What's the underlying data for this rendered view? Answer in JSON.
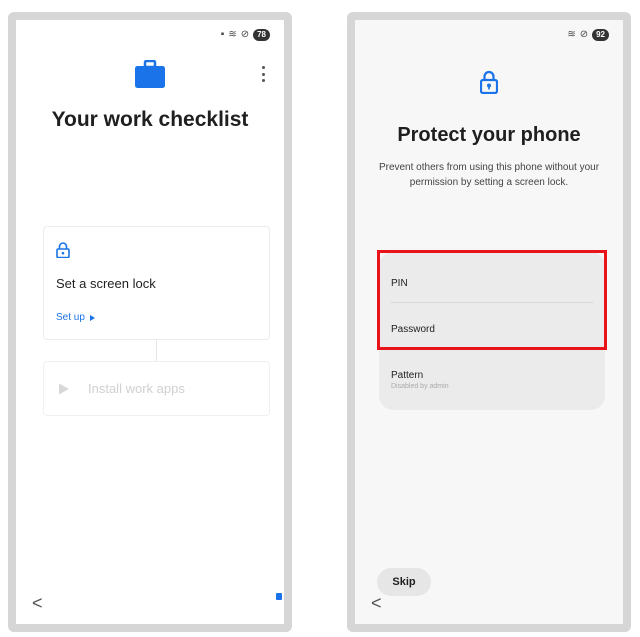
{
  "left_screen": {
    "status": {
      "battery": "78"
    },
    "title": "Your work checklist",
    "tasks": [
      {
        "label": "Set a screen lock",
        "action": "Set up"
      },
      {
        "label": "Install work apps"
      }
    ],
    "colors": {
      "accent": "#1a73e8"
    }
  },
  "right_screen": {
    "status": {
      "battery": "92"
    },
    "title": "Protect your phone",
    "description": "Prevent others from using this phone without your permission by setting a screen lock.",
    "options": [
      {
        "label": "PIN"
      },
      {
        "label": "Password"
      },
      {
        "label": "Pattern",
        "sublabel": "Disabled by admin"
      }
    ],
    "skip": "Skip",
    "colors": {
      "highlight": "#e8141a",
      "lock_icon": "#1a73e8"
    }
  },
  "nav": {
    "back_glyph": "<"
  }
}
